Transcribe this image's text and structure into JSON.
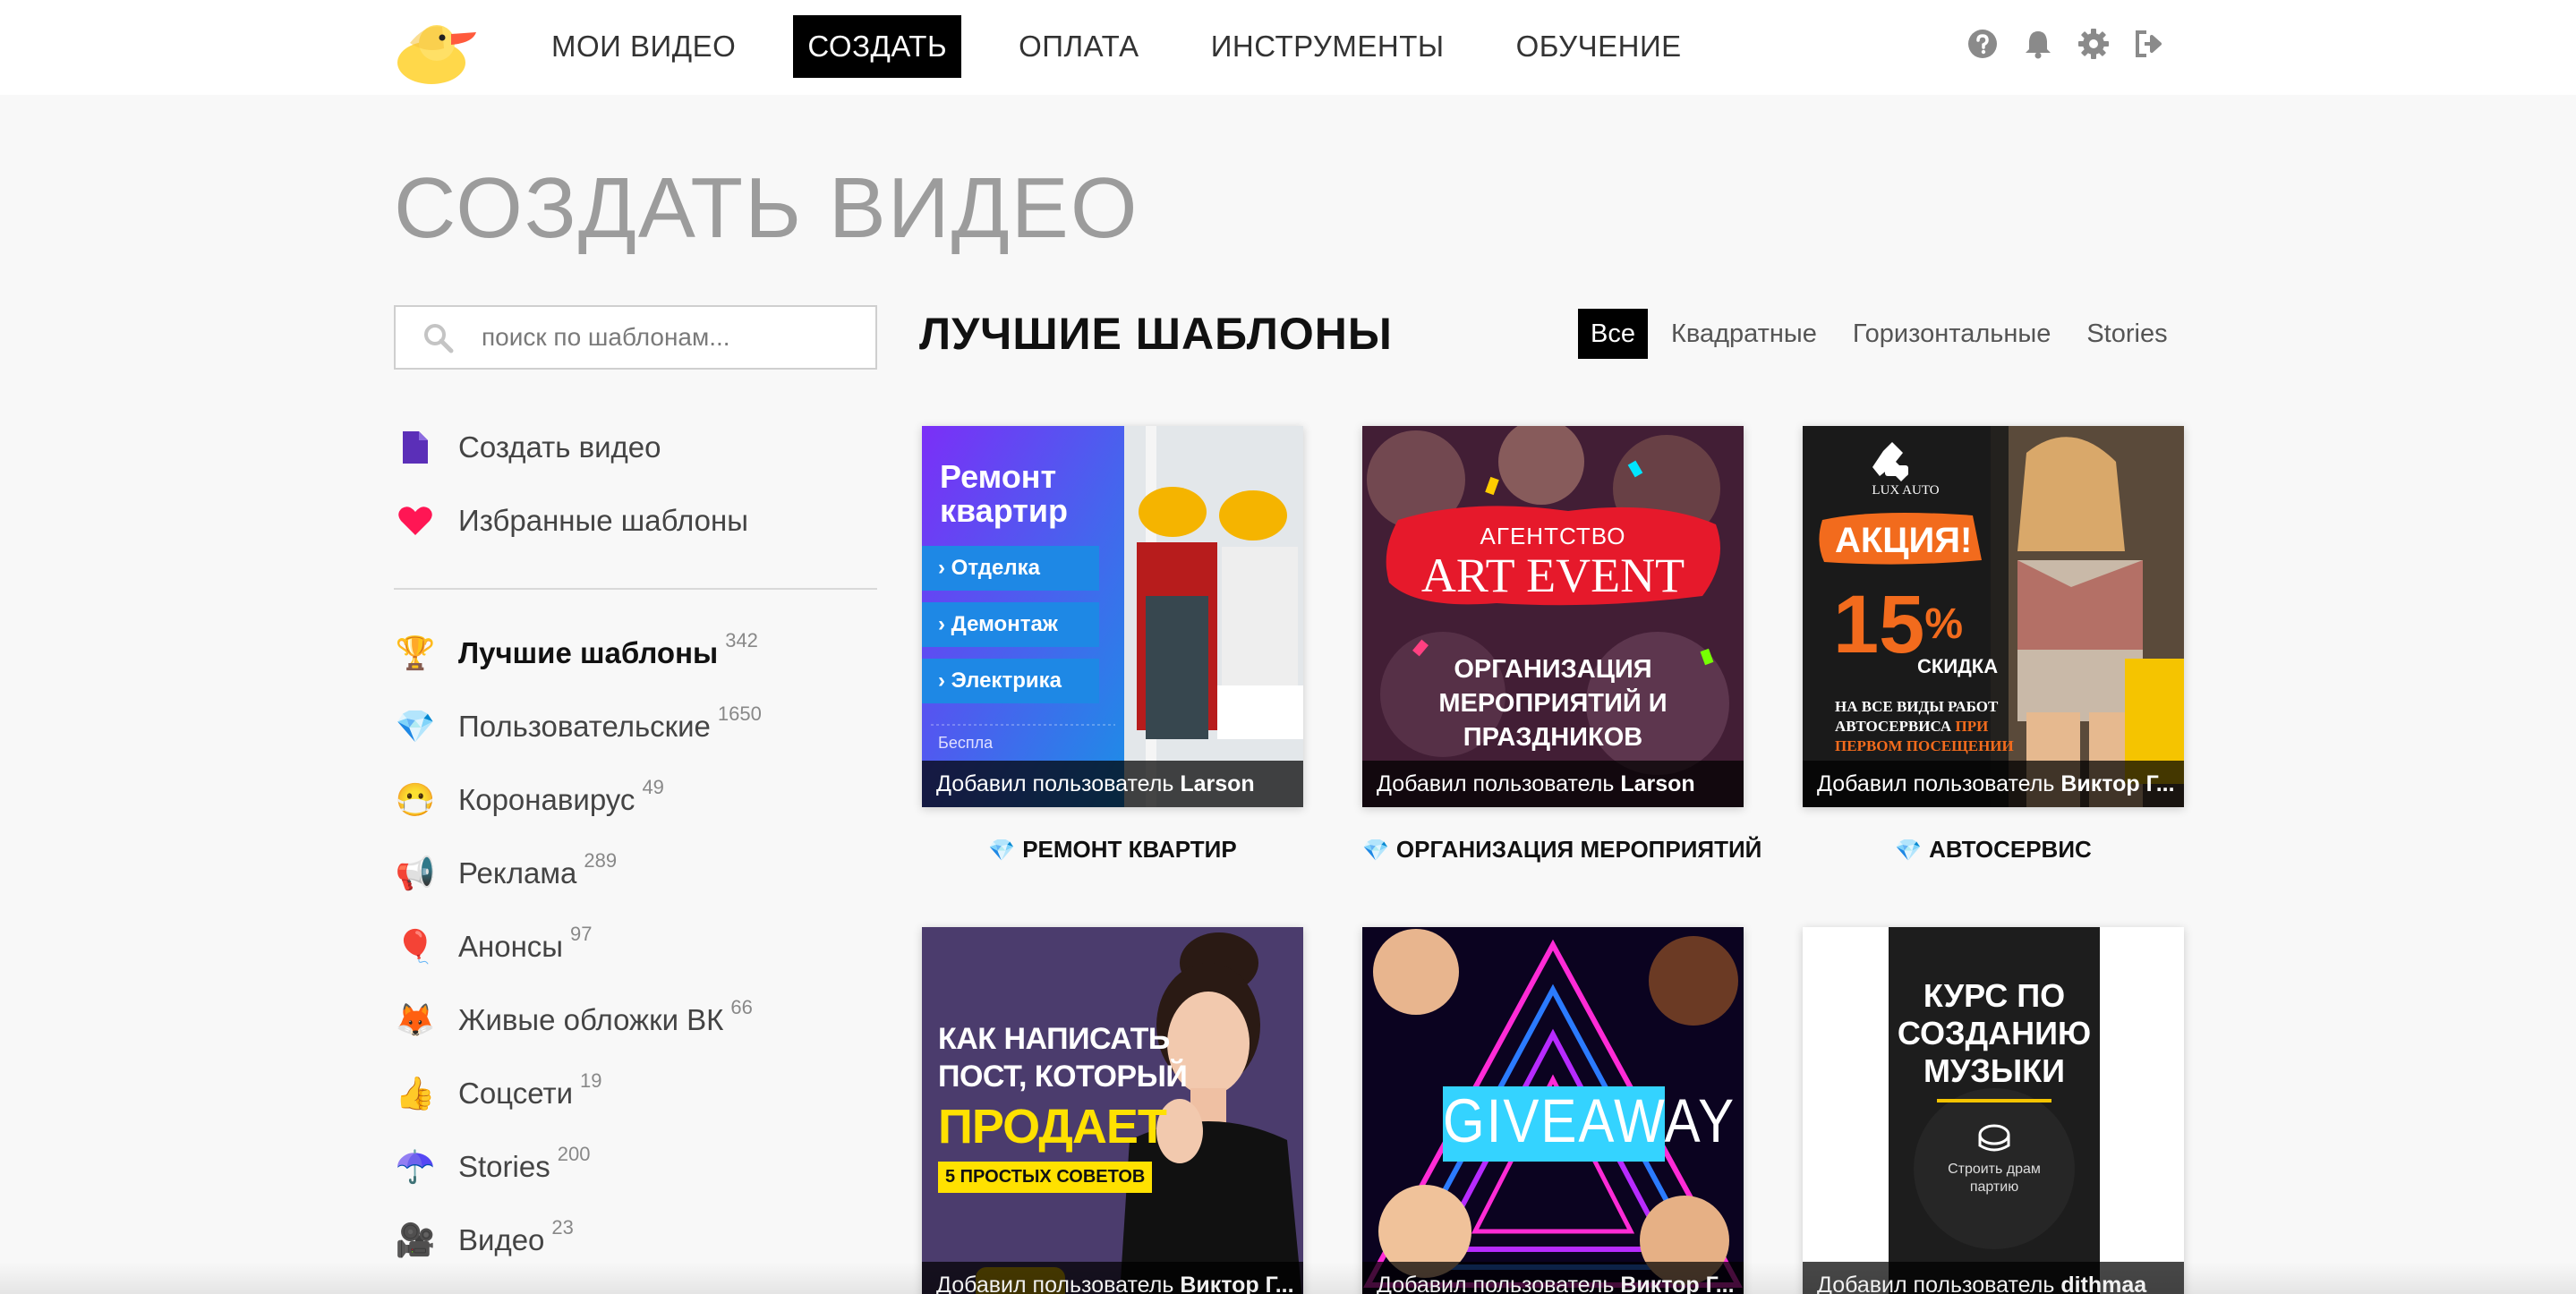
{
  "nav": {
    "items": [
      {
        "label": "МОИ ВИДЕО"
      },
      {
        "label": "СОЗДАТЬ",
        "active": true
      },
      {
        "label": "ОПЛАТА"
      },
      {
        "label": "ИНСТРУМЕНТЫ"
      },
      {
        "label": "ОБУЧЕНИЕ"
      }
    ],
    "icons": [
      "help-icon",
      "bell-icon",
      "gear-icon",
      "logout-icon"
    ]
  },
  "page": {
    "title": "СОЗДАТЬ ВИДЕО"
  },
  "search": {
    "placeholder": "поиск по шаблонам..."
  },
  "sidebar": {
    "top_items": [
      {
        "label": "Создать видео",
        "icon": "document-icon"
      },
      {
        "label": "Избранные шаблоны",
        "icon": "heart-icon"
      }
    ],
    "categories": [
      {
        "label": "Лучшие шаблоны",
        "count": "342",
        "icon": "🏆",
        "active": true
      },
      {
        "label": "Пользовательские",
        "count": "1650",
        "icon": "💎"
      },
      {
        "label": "Коронавирус",
        "count": "49",
        "icon": "😷"
      },
      {
        "label": "Реклама",
        "count": "289",
        "icon": "📢"
      },
      {
        "label": "Анонсы",
        "count": "97",
        "icon": "🎈"
      },
      {
        "label": "Живые обложки ВК",
        "count": "66",
        "icon": "🦊"
      },
      {
        "label": "Соцсети",
        "count": "19",
        "icon": "👍"
      },
      {
        "label": "Stories",
        "count": "200",
        "icon": "☂️"
      },
      {
        "label": "Видео",
        "count": "23",
        "icon": "🎥"
      }
    ]
  },
  "section": {
    "title": "ЛУЧШИЕ ШАБЛОНЫ",
    "filters": [
      {
        "label": "Все",
        "active": true
      },
      {
        "label": "Квадратные"
      },
      {
        "label": "Горизонтальные"
      },
      {
        "label": "Stories"
      }
    ]
  },
  "cards": [
    {
      "title": "РЕМОНТ КВАРТИР",
      "by_prefix": "Добавил пользователь",
      "by_user": "Larson",
      "art": {
        "heading": "Ремонт квартир",
        "items": [
          "Отделка",
          "Демонтаж",
          "Электрика"
        ],
        "footer": "Беспла"
      }
    },
    {
      "title": "ОРГАНИЗАЦИЯ МЕРОПРИЯТИЙ",
      "by_prefix": "Добавил пользователь",
      "by_user": "Larson",
      "art": {
        "kicker": "АГЕНТСТВО",
        "brand": "ART EVENT",
        "line1": "ОРГАНИЗАЦИЯ",
        "line2": "МЕРОПРИЯТИЙ И",
        "line3": "ПРАЗДНИКОВ"
      }
    },
    {
      "title": "АВТОСЕРВИС",
      "by_prefix": "Добавил пользователь",
      "by_user": "Виктор Г...",
      "art": {
        "logo": "LUX AUTO",
        "promo": "АКЦИЯ!",
        "percent": "15",
        "percent_sign": "%",
        "discount": "СКИДКА",
        "desc1": "НА ВСЕ ВИДЫ РАБОТ",
        "desc2": "АВТОСЕРВИСА",
        "desc2_accent": "ПРИ",
        "desc3": "ПЕРВОМ ПОСЕЩЕНИИ"
      }
    },
    {
      "by_prefix": "Добавил пользователь",
      "by_user": "Виктор Г...",
      "art": {
        "line1": "КАК НАПИСАТЬ",
        "line2": "ПОСТ, КОТОРЫЙ",
        "line3": "ПРОДАЕТ",
        "badge": "5 ПРОСТЫХ СОВЕТОВ"
      }
    },
    {
      "by_prefix": "Добавил пользователь",
      "by_user": "Виктор Г...",
      "art": {
        "word": "GIVEAWAY"
      }
    },
    {
      "by_prefix": "Добавил пользователь",
      "by_user": "dithmaa",
      "art": {
        "line1": "КУРС ПО",
        "line2": "СОЗДАНИЮ",
        "line3": "МУЗЫКИ",
        "sub1": "Строить драм",
        "sub2": "партию"
      }
    }
  ],
  "colors": {
    "accent_black": "#000000",
    "heart": "#ff1654",
    "doc": "#5b2fb8",
    "renovation_blue": "#1e88e5",
    "event_red": "#e6192b",
    "auto_orange": "#f26b1d",
    "post_yellow": "#ffe100",
    "giveaway_cyan": "#34d3ff"
  }
}
